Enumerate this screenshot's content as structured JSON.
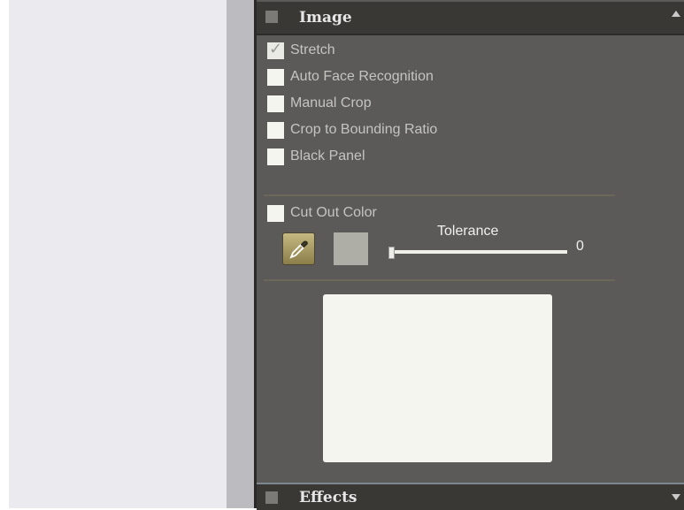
{
  "image_section": {
    "title": "Image",
    "options": [
      {
        "label": "Stretch",
        "checked": true
      },
      {
        "label": "Auto Face Recognition",
        "checked": false
      },
      {
        "label": "Manual Crop",
        "checked": false
      },
      {
        "label": "Crop to Bounding Ratio",
        "checked": false
      },
      {
        "label": "Black Panel",
        "checked": false
      }
    ],
    "cut_out_color": {
      "label": "Cut Out Color",
      "checked": false
    },
    "picker_icon": "eyedropper-icon",
    "swatch_color": "#aeaea7",
    "tolerance": {
      "label": "Tolerance",
      "value": "0",
      "level": 0
    }
  },
  "effects_section": {
    "title": "Effects"
  },
  "colors": {
    "panel_bg": "#5b5a58",
    "header_bg": "#3a3835",
    "preview_bg": "#f5f5ef"
  }
}
